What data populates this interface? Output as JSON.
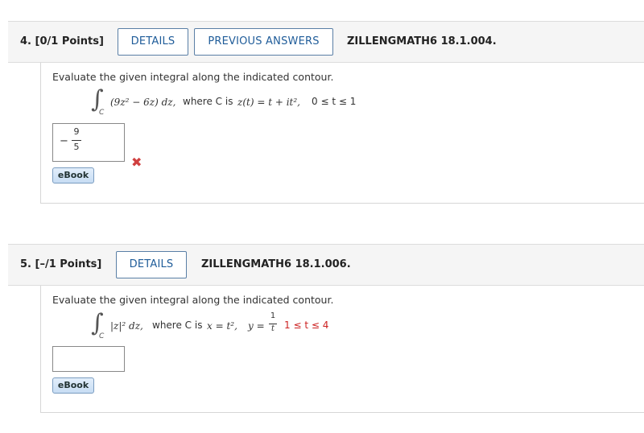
{
  "q4": {
    "number_label": "4. [0/1 Points]",
    "details_label": "DETAILS",
    "previous_label": "PREVIOUS ANSWERS",
    "reference": "ZILLENGMATH6 18.1.004.",
    "prompt": "Evaluate the given integral along the indicated contour.",
    "integral_sub": "C",
    "integrand": "(9z² − 6z) dz,",
    "where_text": "where C is",
    "contour": "z(t) = t + it²,",
    "range": "0 ≤ t ≤ 1",
    "answer_sign": "−",
    "answer_num": "9",
    "answer_den": "5",
    "answer_status": "incorrect",
    "ebook_label": "eBook"
  },
  "q5": {
    "number_label": "5. [–/1 Points]",
    "details_label": "DETAILS",
    "reference": "ZILLENGMATH6 18.1.006.",
    "prompt": "Evaluate the given integral along the indicated contour.",
    "integral_sub": "C",
    "integrand": "|z|² dz,",
    "where_text": "where C is",
    "contour_x": "x = t²,",
    "contour_y": "y =",
    "y_num": "1",
    "y_den": "t",
    "range": "1 ≤ t ≤ 4",
    "answer_value": "",
    "ebook_label": "eBook"
  },
  "colors": {
    "button_text": "#1f5c99",
    "button_border": "#5a7fa6",
    "incorrect_mark": "#d04040",
    "range_highlight": "#cc2222"
  }
}
